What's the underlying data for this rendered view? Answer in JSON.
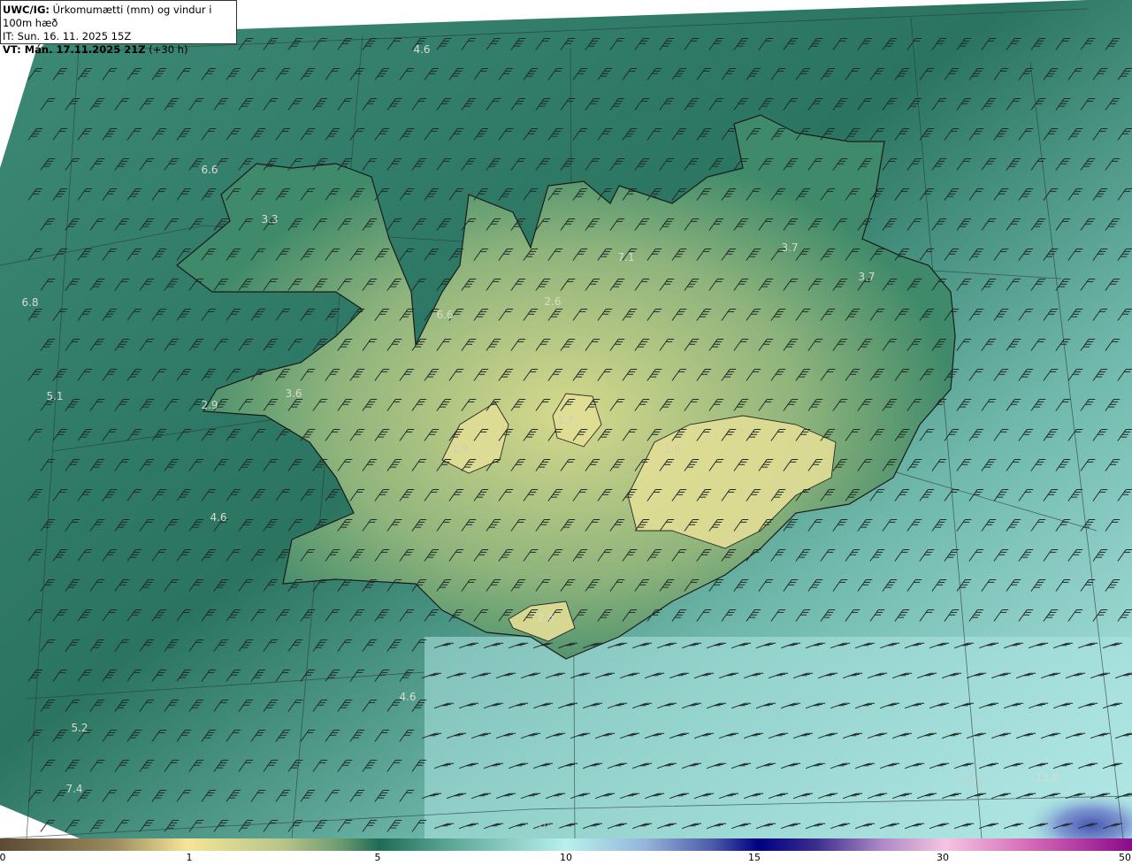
{
  "header": {
    "model": "UWC/IG:",
    "title": "Úrkomumætti (mm) og vindur i 100m hæð",
    "it_line": "IT: Sun. 16. 11. 2025 15Z",
    "vt_bold": "VT: Mán. 17.11.2025 21Z",
    "vt_lead": "(+30 h)"
  },
  "map_labels": [
    "4.6",
    "6.6",
    "3.3",
    "7.1",
    "3.7",
    "3.7",
    "6.8",
    "6.6",
    "2.6",
    "5.1",
    "2.9",
    "3.6",
    "1.9",
    "1.7",
    "1.6",
    "4.6",
    "2.6",
    "4.6",
    "5.2",
    "7.4",
    "10.1",
    "13.8",
    "10.4"
  ],
  "colorbar": {
    "ticks": [
      "0",
      "1",
      "5",
      "10",
      "15",
      "30",
      "50"
    ],
    "colors": [
      "#5c4a33",
      "#f6e596",
      "#1f6c58",
      "#b8f0ee",
      "#000080",
      "#f6c4e2",
      "#8a0a8a"
    ]
  }
}
